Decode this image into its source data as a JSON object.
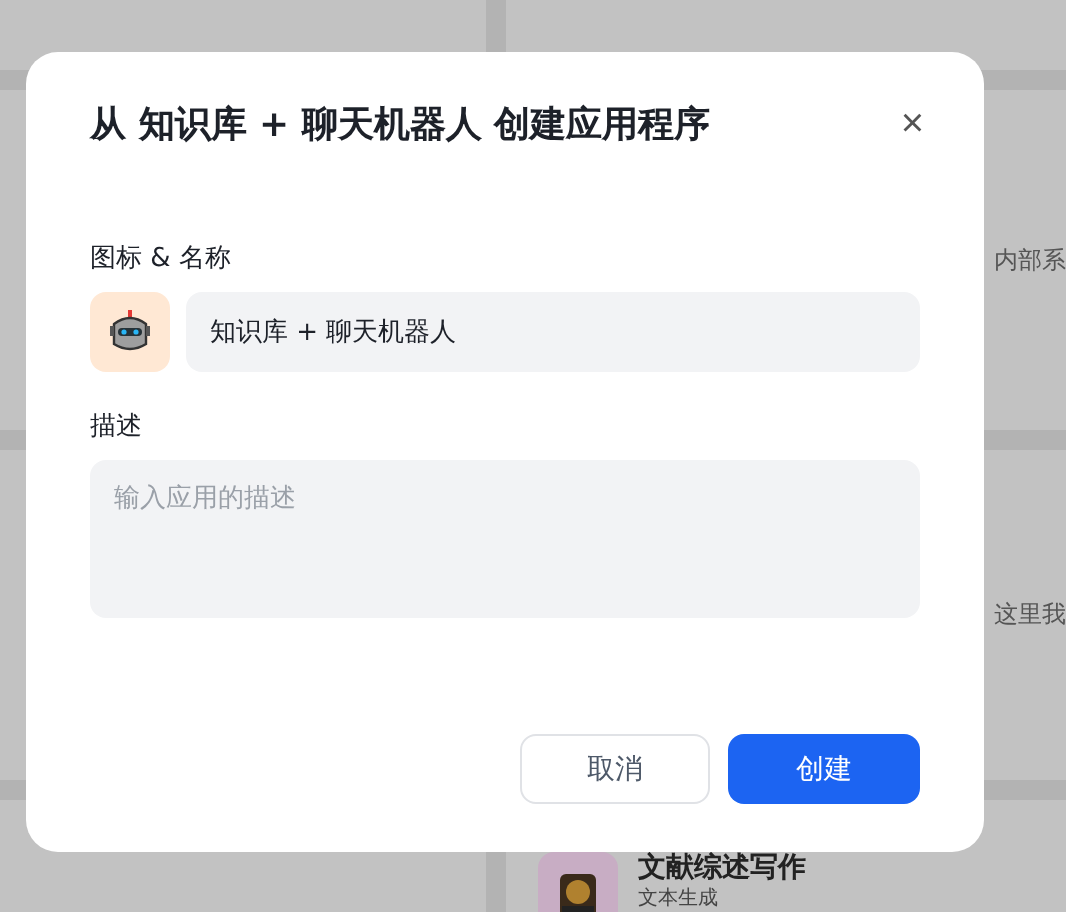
{
  "background": {
    "right_fragments": [
      "内部系",
      "这里我"
    ],
    "bottom_card": {
      "title": "文献综述写作",
      "subtitle": "文本生成"
    }
  },
  "dialog": {
    "title": "从 知识库 + 聊天机器人 创建应用程序",
    "close": "×",
    "name_label": "图标 & 名称",
    "name_value": "知识库 + 聊天机器人",
    "description_label": "描述",
    "description_placeholder": "输入应用的描述",
    "buttons": [
      {
        "label": "取消",
        "kind": "secondary"
      },
      {
        "label": "创建",
        "kind": "primary"
      }
    ]
  }
}
